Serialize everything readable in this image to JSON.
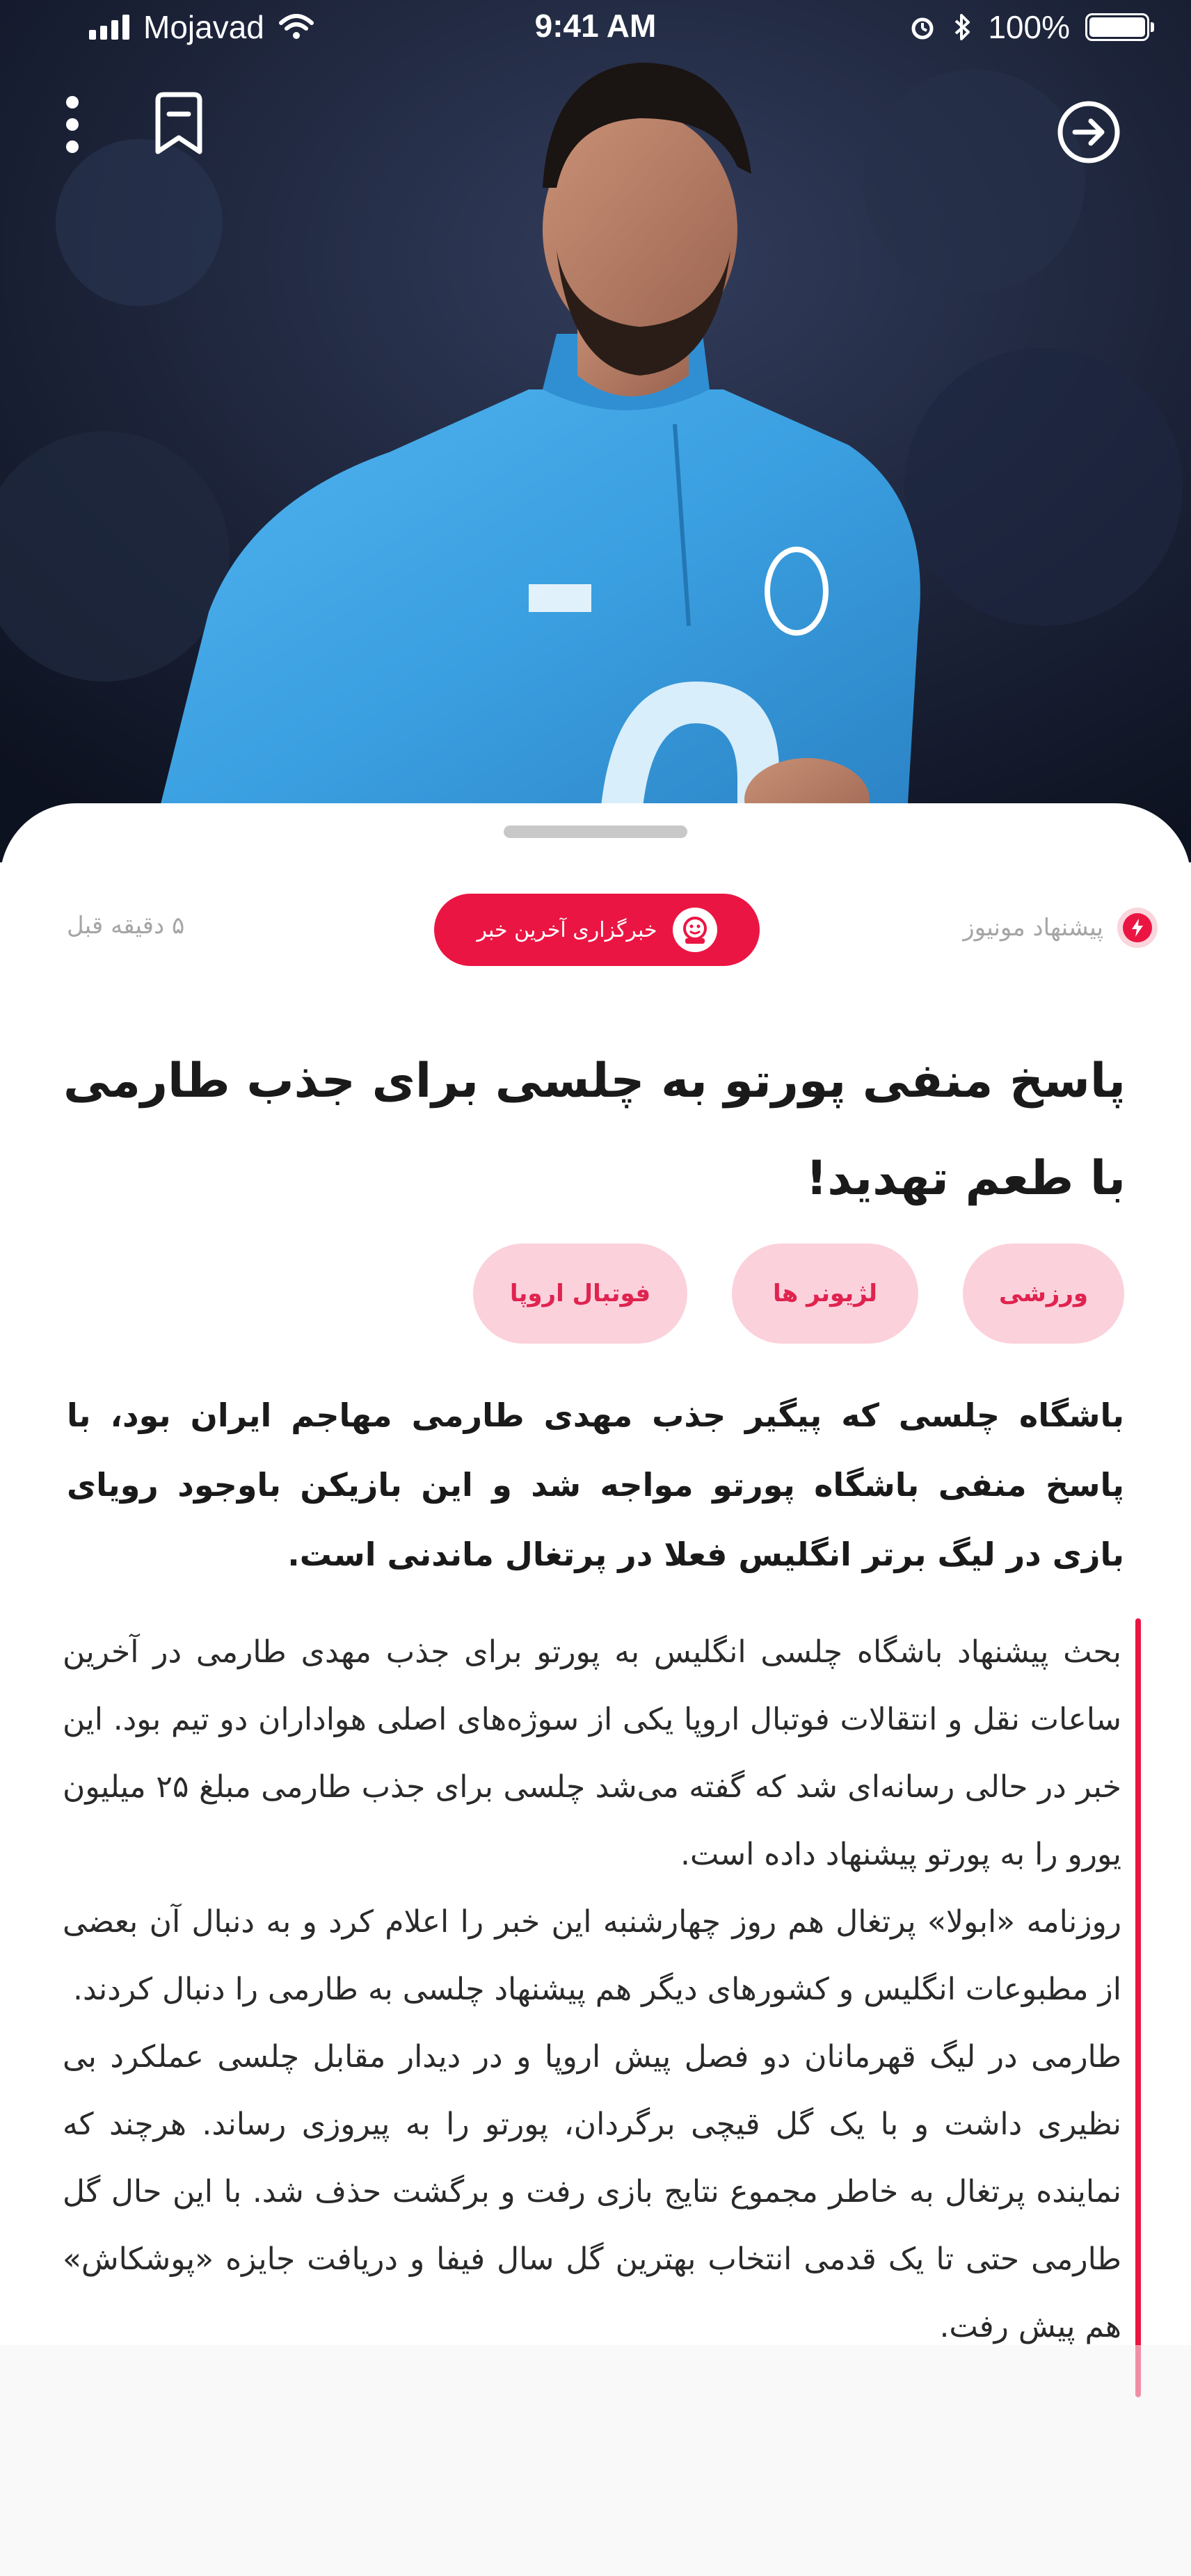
{
  "status_bar": {
    "carrier": "Mojavad",
    "time": "9:41 AM",
    "battery": "100%"
  },
  "icons": {
    "more": "vertical-dots-icon",
    "bookmark": "bookmark-icon",
    "back": "arrow-right-circle-icon"
  },
  "meta": {
    "suggestion": "پیشنهاد مونیوز",
    "agency": "خبرگزاری آخرین خبر",
    "time_ago": "۵ دقیقه قبل"
  },
  "article": {
    "title": "پاسخ منفی پورتو به چلسی برای جذب طارمی با طعم تهدید!",
    "tags": [
      "ورزشی",
      "لژیونر ها",
      "فوتبال اروپا"
    ],
    "lead": "باشگاه چلسی که پیگیر جذب مهدی طارمی مهاجم ایران بود، با پاسخ منفی باشگاه پورتو مواجه شد و این بازیکن باوجود رویای بازی در لیگ برتر انگلیس فعلا در پرتغال ماندنی است.",
    "paragraphs": [
      "بحث پیشنهاد باشگاه چلسی انگلیس به پورتو برای جذب مهدی طارمی در آخرین ساعات نقل و انتقالات فوتبال اروپا یکی از سوژه‌های اصلی هواداران دو تیم بود. این خبر در حالی رسانه‌ای شد که گفته می‌شد چلسی برای جذب طارمی مبلغ ۲۵ میلیون یورو را به پورتو پیشنهاد داده است.",
      "روزنامه «ابولا» پرتغال هم روز چهارشنبه این خبر را اعلام کرد و به دنبال آن بعضی از مطبوعات انگلیس و کشورهای دیگر هم پیشنهاد چلسی به طارمی را دنبال کردند.",
      "طارمی در لیگ قهرمانان دو فصل پیش اروپا و در دیدار مقابل چلسی عملکرد بی نظیری داشت و با یک گل قیچی برگردان، پورتو را به پیروزی رساند. هرچند که نماینده پرتغال به خاطر مجموع نتایج بازی رفت و برگشت حذف شد. با این حال گل طارمی حتی تا یک قدمی انتخاب بهترین گل سال فیفا و دریافت جایزه «پوشکاش» هم پیش رفت."
    ]
  },
  "colors": {
    "accent": "#eb1543",
    "tag_bg": "#fbd1dc",
    "tag_text": "#e0234f",
    "muted": "#a5a5a5",
    "jersey": "#3a9fe0"
  }
}
